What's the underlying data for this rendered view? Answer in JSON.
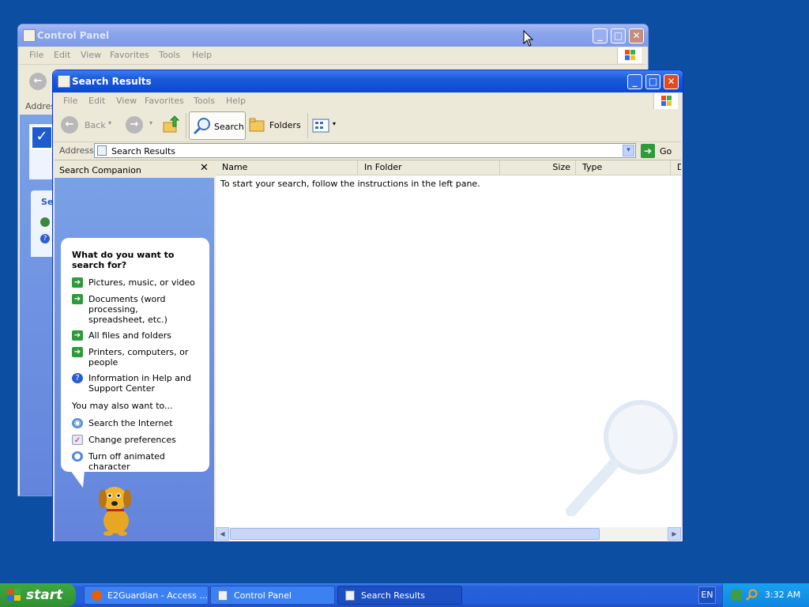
{
  "control_panel": {
    "title": "Control Panel",
    "menu": [
      "File",
      "Edit",
      "View",
      "Favorites",
      "Tools",
      "Help"
    ],
    "address_label": "Addres",
    "sidebar_heading_fragment": "Se"
  },
  "search_window": {
    "title": "Search Results",
    "menu": [
      "File",
      "Edit",
      "View",
      "Favorites",
      "Tools",
      "Help"
    ],
    "toolbar": {
      "back_label": "Back",
      "search_label": "Search",
      "folders_label": "Folders"
    },
    "address": {
      "label": "Address",
      "value": "Search Results",
      "go_label": "Go"
    },
    "companion": {
      "title": "Search Companion",
      "question": "What do you want to search for?",
      "options": [
        "Pictures, music, or video",
        "Documents (word processing, spreadsheet, etc.)",
        "All files and folders",
        "Printers, computers, or people",
        "Information in Help and Support Center"
      ],
      "also_heading": "You may also want to...",
      "also_options": [
        "Search the Internet",
        "Change preferences",
        "Turn off animated character"
      ]
    },
    "columns": [
      "Name",
      "In Folder",
      "Size",
      "Type",
      "D"
    ],
    "instruction": "To start your search, follow the instructions in the left pane."
  },
  "taskbar": {
    "start_label": "start",
    "buttons": [
      "E2Guardian - Access ...",
      "Control Panel",
      "Search Results"
    ],
    "language": "EN",
    "clock": "3:32 AM"
  }
}
